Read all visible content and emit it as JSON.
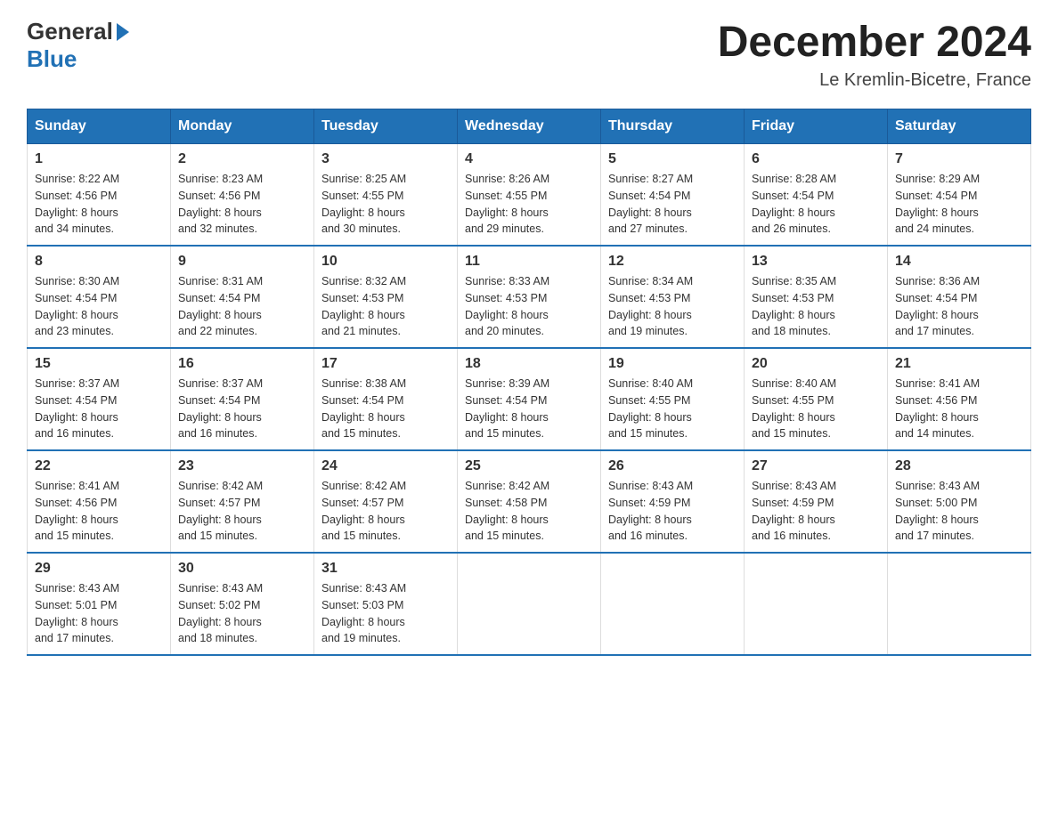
{
  "header": {
    "logo": {
      "general": "General",
      "blue": "Blue",
      "arrow_color": "#2171b5"
    },
    "title": "December 2024",
    "location": "Le Kremlin-Bicetre, France"
  },
  "calendar": {
    "days_of_week": [
      "Sunday",
      "Monday",
      "Tuesday",
      "Wednesday",
      "Thursday",
      "Friday",
      "Saturday"
    ],
    "weeks": [
      [
        {
          "day": "1",
          "sunrise": "8:22 AM",
          "sunset": "4:56 PM",
          "daylight": "8 hours and 34 minutes."
        },
        {
          "day": "2",
          "sunrise": "8:23 AM",
          "sunset": "4:56 PM",
          "daylight": "8 hours and 32 minutes."
        },
        {
          "day": "3",
          "sunrise": "8:25 AM",
          "sunset": "4:55 PM",
          "daylight": "8 hours and 30 minutes."
        },
        {
          "day": "4",
          "sunrise": "8:26 AM",
          "sunset": "4:55 PM",
          "daylight": "8 hours and 29 minutes."
        },
        {
          "day": "5",
          "sunrise": "8:27 AM",
          "sunset": "4:54 PM",
          "daylight": "8 hours and 27 minutes."
        },
        {
          "day": "6",
          "sunrise": "8:28 AM",
          "sunset": "4:54 PM",
          "daylight": "8 hours and 26 minutes."
        },
        {
          "day": "7",
          "sunrise": "8:29 AM",
          "sunset": "4:54 PM",
          "daylight": "8 hours and 24 minutes."
        }
      ],
      [
        {
          "day": "8",
          "sunrise": "8:30 AM",
          "sunset": "4:54 PM",
          "daylight": "8 hours and 23 minutes."
        },
        {
          "day": "9",
          "sunrise": "8:31 AM",
          "sunset": "4:54 PM",
          "daylight": "8 hours and 22 minutes."
        },
        {
          "day": "10",
          "sunrise": "8:32 AM",
          "sunset": "4:53 PM",
          "daylight": "8 hours and 21 minutes."
        },
        {
          "day": "11",
          "sunrise": "8:33 AM",
          "sunset": "4:53 PM",
          "daylight": "8 hours and 20 minutes."
        },
        {
          "day": "12",
          "sunrise": "8:34 AM",
          "sunset": "4:53 PM",
          "daylight": "8 hours and 19 minutes."
        },
        {
          "day": "13",
          "sunrise": "8:35 AM",
          "sunset": "4:53 PM",
          "daylight": "8 hours and 18 minutes."
        },
        {
          "day": "14",
          "sunrise": "8:36 AM",
          "sunset": "4:54 PM",
          "daylight": "8 hours and 17 minutes."
        }
      ],
      [
        {
          "day": "15",
          "sunrise": "8:37 AM",
          "sunset": "4:54 PM",
          "daylight": "8 hours and 16 minutes."
        },
        {
          "day": "16",
          "sunrise": "8:37 AM",
          "sunset": "4:54 PM",
          "daylight": "8 hours and 16 minutes."
        },
        {
          "day": "17",
          "sunrise": "8:38 AM",
          "sunset": "4:54 PM",
          "daylight": "8 hours and 15 minutes."
        },
        {
          "day": "18",
          "sunrise": "8:39 AM",
          "sunset": "4:54 PM",
          "daylight": "8 hours and 15 minutes."
        },
        {
          "day": "19",
          "sunrise": "8:40 AM",
          "sunset": "4:55 PM",
          "daylight": "8 hours and 15 minutes."
        },
        {
          "day": "20",
          "sunrise": "8:40 AM",
          "sunset": "4:55 PM",
          "daylight": "8 hours and 15 minutes."
        },
        {
          "day": "21",
          "sunrise": "8:41 AM",
          "sunset": "4:56 PM",
          "daylight": "8 hours and 14 minutes."
        }
      ],
      [
        {
          "day": "22",
          "sunrise": "8:41 AM",
          "sunset": "4:56 PM",
          "daylight": "8 hours and 15 minutes."
        },
        {
          "day": "23",
          "sunrise": "8:42 AM",
          "sunset": "4:57 PM",
          "daylight": "8 hours and 15 minutes."
        },
        {
          "day": "24",
          "sunrise": "8:42 AM",
          "sunset": "4:57 PM",
          "daylight": "8 hours and 15 minutes."
        },
        {
          "day": "25",
          "sunrise": "8:42 AM",
          "sunset": "4:58 PM",
          "daylight": "8 hours and 15 minutes."
        },
        {
          "day": "26",
          "sunrise": "8:43 AM",
          "sunset": "4:59 PM",
          "daylight": "8 hours and 16 minutes."
        },
        {
          "day": "27",
          "sunrise": "8:43 AM",
          "sunset": "4:59 PM",
          "daylight": "8 hours and 16 minutes."
        },
        {
          "day": "28",
          "sunrise": "8:43 AM",
          "sunset": "5:00 PM",
          "daylight": "8 hours and 17 minutes."
        }
      ],
      [
        {
          "day": "29",
          "sunrise": "8:43 AM",
          "sunset": "5:01 PM",
          "daylight": "8 hours and 17 minutes."
        },
        {
          "day": "30",
          "sunrise": "8:43 AM",
          "sunset": "5:02 PM",
          "daylight": "8 hours and 18 minutes."
        },
        {
          "day": "31",
          "sunrise": "8:43 AM",
          "sunset": "5:03 PM",
          "daylight": "8 hours and 19 minutes."
        },
        null,
        null,
        null,
        null
      ]
    ]
  }
}
